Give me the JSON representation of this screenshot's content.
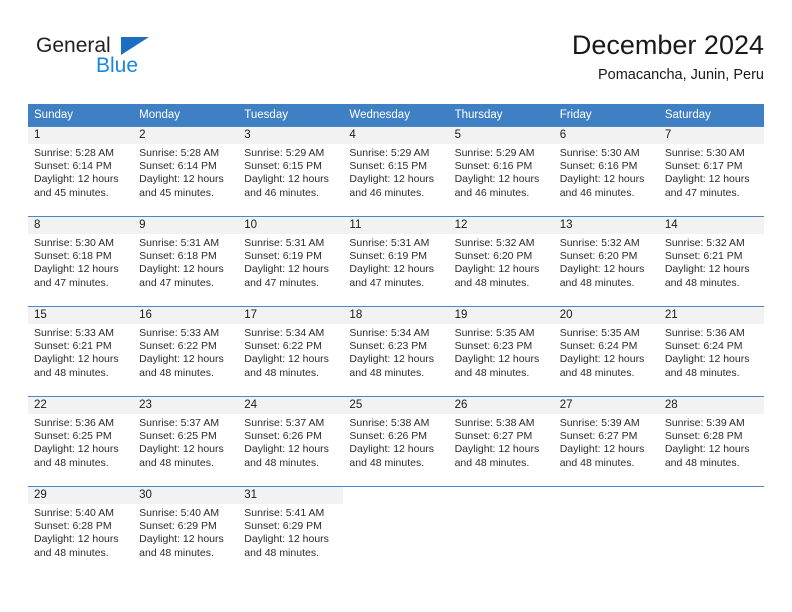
{
  "brand": {
    "name_top": "General",
    "name_bottom": "Blue",
    "accent_color": "#1b87dc",
    "triangle_color": "#1b6ec2"
  },
  "header": {
    "title": "December 2024",
    "subtitle": "Pomacancha, Junin, Peru"
  },
  "calendar": {
    "header_bg": "#3f80c4",
    "daynum_bg": "#f2f2f2",
    "row_line_color": "#4a86c8",
    "weekdays": [
      "Sunday",
      "Monday",
      "Tuesday",
      "Wednesday",
      "Thursday",
      "Friday",
      "Saturday"
    ],
    "weeks": [
      [
        {
          "day": "1",
          "sunrise": "Sunrise: 5:28 AM",
          "sunset": "Sunset: 6:14 PM",
          "daylight1": "Daylight: 12 hours",
          "daylight2": "and 45 minutes."
        },
        {
          "day": "2",
          "sunrise": "Sunrise: 5:28 AM",
          "sunset": "Sunset: 6:14 PM",
          "daylight1": "Daylight: 12 hours",
          "daylight2": "and 45 minutes."
        },
        {
          "day": "3",
          "sunrise": "Sunrise: 5:29 AM",
          "sunset": "Sunset: 6:15 PM",
          "daylight1": "Daylight: 12 hours",
          "daylight2": "and 46 minutes."
        },
        {
          "day": "4",
          "sunrise": "Sunrise: 5:29 AM",
          "sunset": "Sunset: 6:15 PM",
          "daylight1": "Daylight: 12 hours",
          "daylight2": "and 46 minutes."
        },
        {
          "day": "5",
          "sunrise": "Sunrise: 5:29 AM",
          "sunset": "Sunset: 6:16 PM",
          "daylight1": "Daylight: 12 hours",
          "daylight2": "and 46 minutes."
        },
        {
          "day": "6",
          "sunrise": "Sunrise: 5:30 AM",
          "sunset": "Sunset: 6:16 PM",
          "daylight1": "Daylight: 12 hours",
          "daylight2": "and 46 minutes."
        },
        {
          "day": "7",
          "sunrise": "Sunrise: 5:30 AM",
          "sunset": "Sunset: 6:17 PM",
          "daylight1": "Daylight: 12 hours",
          "daylight2": "and 47 minutes."
        }
      ],
      [
        {
          "day": "8",
          "sunrise": "Sunrise: 5:30 AM",
          "sunset": "Sunset: 6:18 PM",
          "daylight1": "Daylight: 12 hours",
          "daylight2": "and 47 minutes."
        },
        {
          "day": "9",
          "sunrise": "Sunrise: 5:31 AM",
          "sunset": "Sunset: 6:18 PM",
          "daylight1": "Daylight: 12 hours",
          "daylight2": "and 47 minutes."
        },
        {
          "day": "10",
          "sunrise": "Sunrise: 5:31 AM",
          "sunset": "Sunset: 6:19 PM",
          "daylight1": "Daylight: 12 hours",
          "daylight2": "and 47 minutes."
        },
        {
          "day": "11",
          "sunrise": "Sunrise: 5:31 AM",
          "sunset": "Sunset: 6:19 PM",
          "daylight1": "Daylight: 12 hours",
          "daylight2": "and 47 minutes."
        },
        {
          "day": "12",
          "sunrise": "Sunrise: 5:32 AM",
          "sunset": "Sunset: 6:20 PM",
          "daylight1": "Daylight: 12 hours",
          "daylight2": "and 48 minutes."
        },
        {
          "day": "13",
          "sunrise": "Sunrise: 5:32 AM",
          "sunset": "Sunset: 6:20 PM",
          "daylight1": "Daylight: 12 hours",
          "daylight2": "and 48 minutes."
        },
        {
          "day": "14",
          "sunrise": "Sunrise: 5:32 AM",
          "sunset": "Sunset: 6:21 PM",
          "daylight1": "Daylight: 12 hours",
          "daylight2": "and 48 minutes."
        }
      ],
      [
        {
          "day": "15",
          "sunrise": "Sunrise: 5:33 AM",
          "sunset": "Sunset: 6:21 PM",
          "daylight1": "Daylight: 12 hours",
          "daylight2": "and 48 minutes."
        },
        {
          "day": "16",
          "sunrise": "Sunrise: 5:33 AM",
          "sunset": "Sunset: 6:22 PM",
          "daylight1": "Daylight: 12 hours",
          "daylight2": "and 48 minutes."
        },
        {
          "day": "17",
          "sunrise": "Sunrise: 5:34 AM",
          "sunset": "Sunset: 6:22 PM",
          "daylight1": "Daylight: 12 hours",
          "daylight2": "and 48 minutes."
        },
        {
          "day": "18",
          "sunrise": "Sunrise: 5:34 AM",
          "sunset": "Sunset: 6:23 PM",
          "daylight1": "Daylight: 12 hours",
          "daylight2": "and 48 minutes."
        },
        {
          "day": "19",
          "sunrise": "Sunrise: 5:35 AM",
          "sunset": "Sunset: 6:23 PM",
          "daylight1": "Daylight: 12 hours",
          "daylight2": "and 48 minutes."
        },
        {
          "day": "20",
          "sunrise": "Sunrise: 5:35 AM",
          "sunset": "Sunset: 6:24 PM",
          "daylight1": "Daylight: 12 hours",
          "daylight2": "and 48 minutes."
        },
        {
          "day": "21",
          "sunrise": "Sunrise: 5:36 AM",
          "sunset": "Sunset: 6:24 PM",
          "daylight1": "Daylight: 12 hours",
          "daylight2": "and 48 minutes."
        }
      ],
      [
        {
          "day": "22",
          "sunrise": "Sunrise: 5:36 AM",
          "sunset": "Sunset: 6:25 PM",
          "daylight1": "Daylight: 12 hours",
          "daylight2": "and 48 minutes."
        },
        {
          "day": "23",
          "sunrise": "Sunrise: 5:37 AM",
          "sunset": "Sunset: 6:25 PM",
          "daylight1": "Daylight: 12 hours",
          "daylight2": "and 48 minutes."
        },
        {
          "day": "24",
          "sunrise": "Sunrise: 5:37 AM",
          "sunset": "Sunset: 6:26 PM",
          "daylight1": "Daylight: 12 hours",
          "daylight2": "and 48 minutes."
        },
        {
          "day": "25",
          "sunrise": "Sunrise: 5:38 AM",
          "sunset": "Sunset: 6:26 PM",
          "daylight1": "Daylight: 12 hours",
          "daylight2": "and 48 minutes."
        },
        {
          "day": "26",
          "sunrise": "Sunrise: 5:38 AM",
          "sunset": "Sunset: 6:27 PM",
          "daylight1": "Daylight: 12 hours",
          "daylight2": "and 48 minutes."
        },
        {
          "day": "27",
          "sunrise": "Sunrise: 5:39 AM",
          "sunset": "Sunset: 6:27 PM",
          "daylight1": "Daylight: 12 hours",
          "daylight2": "and 48 minutes."
        },
        {
          "day": "28",
          "sunrise": "Sunrise: 5:39 AM",
          "sunset": "Sunset: 6:28 PM",
          "daylight1": "Daylight: 12 hours",
          "daylight2": "and 48 minutes."
        }
      ],
      [
        {
          "day": "29",
          "sunrise": "Sunrise: 5:40 AM",
          "sunset": "Sunset: 6:28 PM",
          "daylight1": "Daylight: 12 hours",
          "daylight2": "and 48 minutes."
        },
        {
          "day": "30",
          "sunrise": "Sunrise: 5:40 AM",
          "sunset": "Sunset: 6:29 PM",
          "daylight1": "Daylight: 12 hours",
          "daylight2": "and 48 minutes."
        },
        {
          "day": "31",
          "sunrise": "Sunrise: 5:41 AM",
          "sunset": "Sunset: 6:29 PM",
          "daylight1": "Daylight: 12 hours",
          "daylight2": "and 48 minutes."
        },
        null,
        null,
        null,
        null
      ]
    ]
  }
}
